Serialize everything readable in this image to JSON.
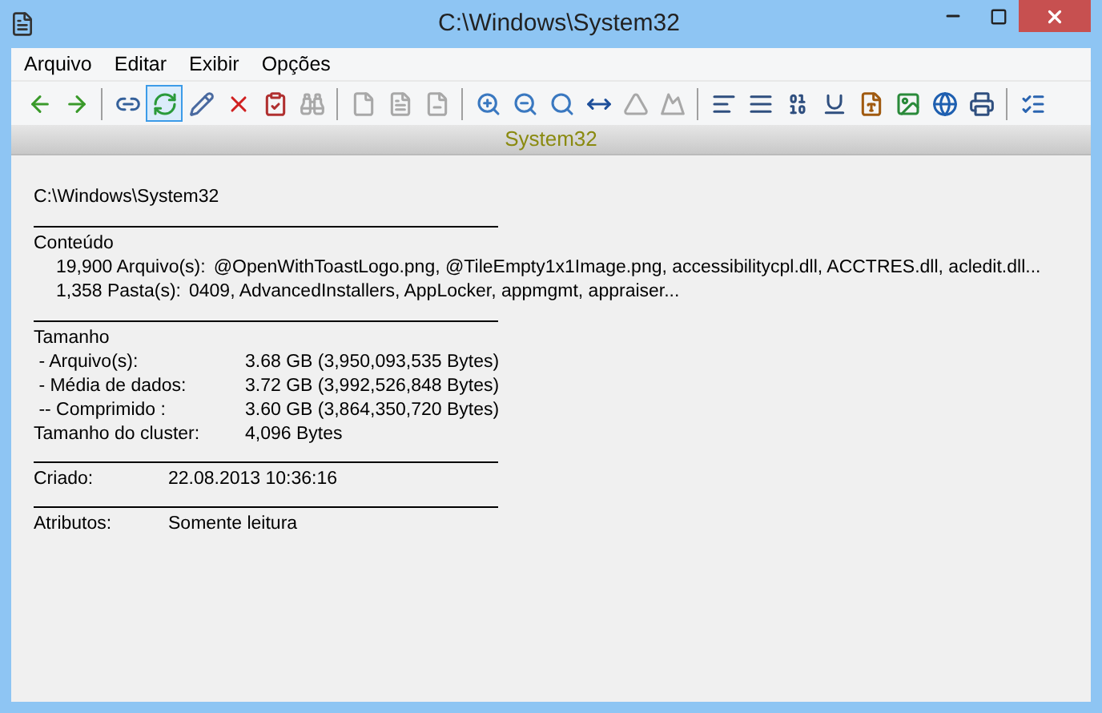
{
  "window": {
    "title": "C:\\Windows\\System32"
  },
  "menu": [
    "Arquivo",
    "Editar",
    "Exibir",
    "Opções"
  ],
  "toolbar": [
    [
      {
        "selected": false,
        "disabled": false
      },
      {
        "selected": false,
        "disabled": false
      }
    ],
    [
      {
        "selected": false,
        "disabled": false
      },
      {
        "selected": true,
        "disabled": false
      },
      {
        "selected": false,
        "disabled": false
      },
      {
        "selected": false,
        "disabled": false
      },
      {
        "selected": false,
        "disabled": false
      },
      {
        "selected": false,
        "disabled": true
      }
    ],
    [
      {
        "selected": false,
        "disabled": true
      },
      {
        "selected": false,
        "disabled": true
      },
      {
        "selected": false,
        "disabled": true
      }
    ],
    [
      {
        "selected": false,
        "disabled": false
      },
      {
        "selected": false,
        "disabled": false
      },
      {
        "selected": false,
        "disabled": false
      },
      {
        "selected": false,
        "disabled": false
      },
      {
        "selected": false,
        "disabled": true
      },
      {
        "selected": false,
        "disabled": true
      }
    ],
    [
      {
        "selected": false,
        "disabled": false
      },
      {
        "selected": false,
        "disabled": false
      },
      {
        "selected": false,
        "disabled": false
      },
      {
        "selected": false,
        "disabled": false
      },
      {
        "selected": false,
        "disabled": false
      },
      {
        "selected": false,
        "disabled": false
      },
      {
        "selected": false,
        "disabled": false
      },
      {
        "selected": false,
        "disabled": false
      }
    ],
    [
      {
        "selected": false,
        "disabled": false
      }
    ]
  ],
  "header": "System32",
  "path": "C:\\Windows\\System32",
  "contents": {
    "title": "Conteúdo",
    "rows": [
      {
        "label": "19,900 Arquivo(s):",
        "value": "@OpenWithToastLogo.png, @TileEmpty1x1Image.png, accessibilitycpl.dll, ACCTRES.dll, acledit.dll..."
      },
      {
        "label": "1,358 Pasta(s):",
        "value": "0409, AdvancedInstallers, AppLocker, appmgmt, appraiser..."
      }
    ]
  },
  "size": {
    "title": "Tamanho",
    "rows": [
      {
        "label": " - Arquivo(s):",
        "value": "3.68 GB (3,950,093,535 Bytes)"
      },
      {
        "label": " - Média de dados:",
        "value": "3.72 GB (3,992,526,848 Bytes)"
      },
      {
        "label": " -- Comprimido :",
        "value": "3.60 GB (3,864,350,720 Bytes)"
      },
      {
        "label": "Tamanho do cluster:",
        "value": "4,096 Bytes"
      }
    ]
  },
  "created": {
    "label": "Criado:",
    "value": "22.08.2013 10:36:16"
  },
  "attributes": {
    "label": "Atributos:",
    "value": "Somente leitura"
  }
}
